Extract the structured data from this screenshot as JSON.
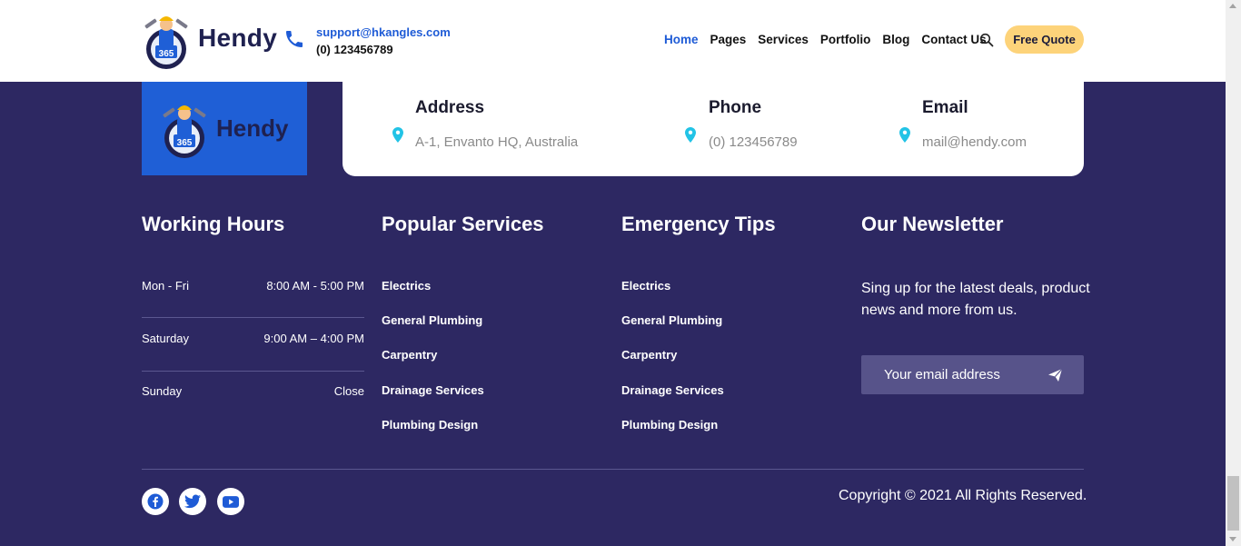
{
  "header": {
    "logo_text": "Hendy",
    "email": "support@hkangles.com",
    "phone": "(0) 123456789",
    "nav": [
      "Home",
      "Pages",
      "Services",
      "Portfolio",
      "Blog",
      "Contact Us"
    ],
    "quote_button": "Free Quote"
  },
  "footer_logo_text": "Hendy",
  "info": [
    {
      "title": "Address",
      "value": "A-1, Envanto HQ, Australia"
    },
    {
      "title": "Phone",
      "value": "(0) 123456789"
    },
    {
      "title": "Email",
      "value": "mail@hendy.com"
    }
  ],
  "working_hours": {
    "title": "Working Hours",
    "rows": [
      {
        "day": "Mon - Fri",
        "time": "8:00 AM - 5:00 PM"
      },
      {
        "day": "Saturday",
        "time": "9:00 AM – 4:00 PM"
      },
      {
        "day": "Sunday",
        "time": "Close"
      }
    ]
  },
  "popular_services": {
    "title": "Popular Services",
    "links": [
      "Electrics",
      "General Plumbing",
      "Carpentry",
      "Drainage Services",
      "Plumbing Design"
    ]
  },
  "emergency_tips": {
    "title": "Emergency Tips",
    "links": [
      "Electrics",
      "General Plumbing",
      "Carpentry",
      "Drainage Services",
      "Plumbing Design"
    ]
  },
  "newsletter": {
    "title": "Our Newsletter",
    "text": "Sing up for the latest deals, product news and more from us.",
    "placeholder": "Your email address"
  },
  "copyright": "Copyright © 2021 All Rights Reserved.",
  "colors": {
    "background": "#2d2862",
    "accent_blue": "#1e5bd6",
    "quote_yellow": "#fdd37a",
    "pin_cyan": "#22c3e6"
  }
}
